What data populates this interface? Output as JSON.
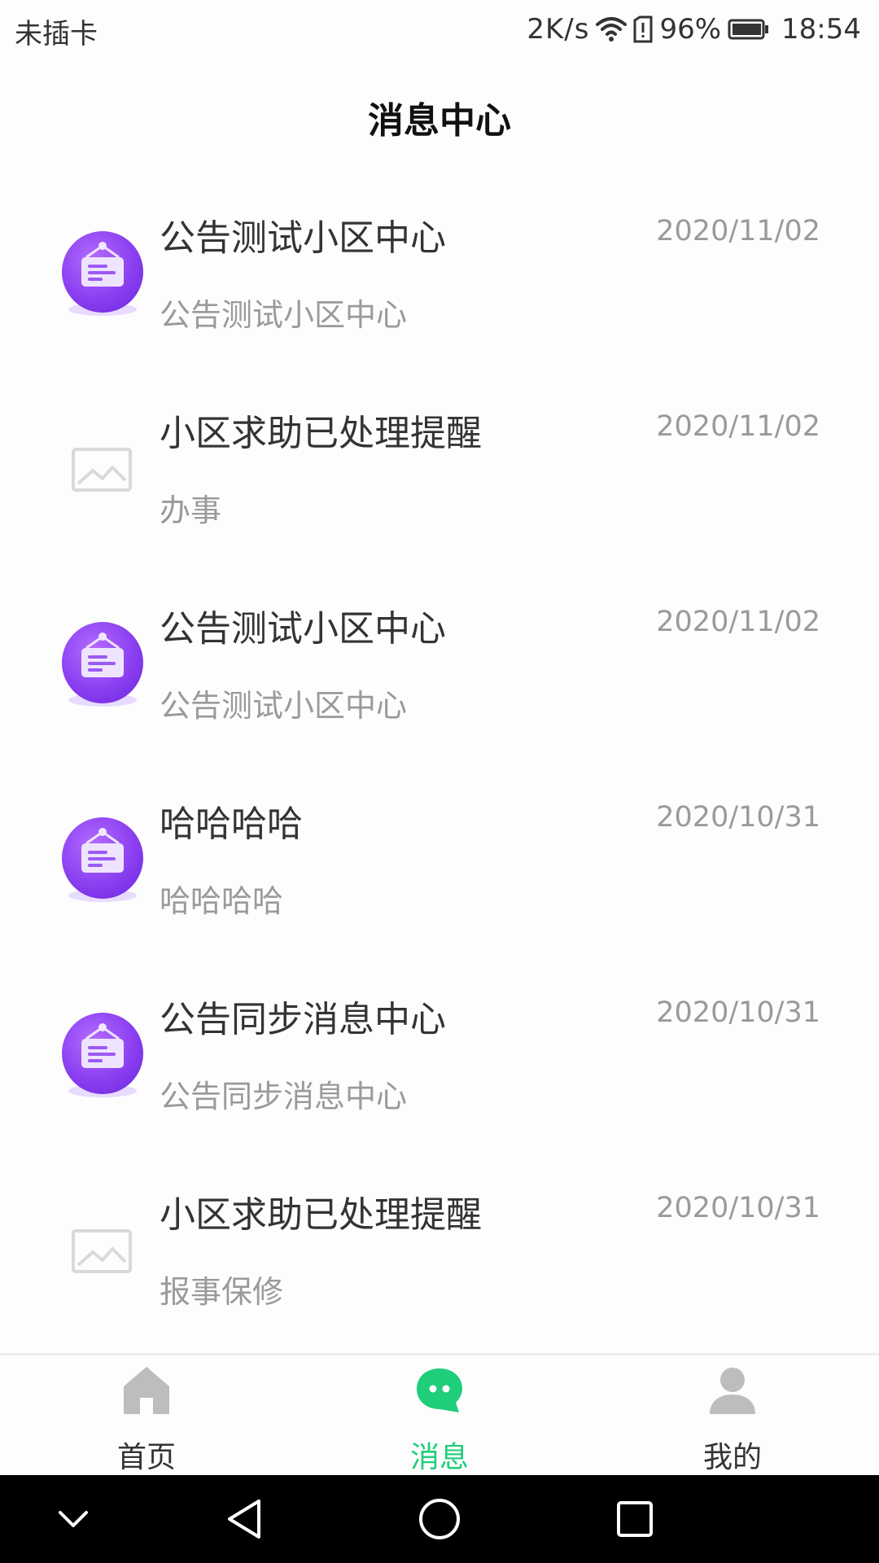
{
  "status_bar": {
    "carrier": "未插卡",
    "speed": "2K/s",
    "battery_percent": "96%",
    "time": "18:54",
    "icons": [
      "wifi-icon",
      "sim-alert-icon",
      "battery-icon"
    ]
  },
  "header": {
    "title": "消息中心"
  },
  "messages": [
    {
      "title": "公告测试小区中心",
      "date": "2020/11/02",
      "subtitle": "公告测试小区中心",
      "icon": "notice-board-icon"
    },
    {
      "title": "小区求助已处理提醒",
      "date": "2020/11/02",
      "subtitle": "办事",
      "icon": "image-placeholder-icon"
    },
    {
      "title": "公告测试小区中心",
      "date": "2020/11/02",
      "subtitle": "公告测试小区中心",
      "icon": "notice-board-icon"
    },
    {
      "title": "哈哈哈哈",
      "date": "2020/10/31",
      "subtitle": "哈哈哈哈",
      "icon": "notice-board-icon"
    },
    {
      "title": "公告同步消息中心",
      "date": "2020/10/31",
      "subtitle": "公告同步消息中心",
      "icon": "notice-board-icon"
    },
    {
      "title": "小区求助已处理提醒",
      "date": "2020/10/31",
      "subtitle": "报事保修",
      "icon": "image-placeholder-icon"
    }
  ],
  "tab_bar": {
    "tabs": [
      {
        "label": "首页",
        "icon": "home-icon",
        "active": false
      },
      {
        "label": "消息",
        "icon": "chat-bubble-icon",
        "active": true
      },
      {
        "label": "我的",
        "icon": "person-icon",
        "active": false
      }
    ]
  },
  "nav_bar": {
    "icons": [
      "chevron-down-icon",
      "back-triangle-icon",
      "home-circle-icon",
      "recents-square-icon"
    ]
  },
  "colors": {
    "accent": "#1fce7a",
    "notice_icon_purple": "#8a3ff0",
    "text_primary": "#333333",
    "text_secondary": "#9a9a9a"
  }
}
